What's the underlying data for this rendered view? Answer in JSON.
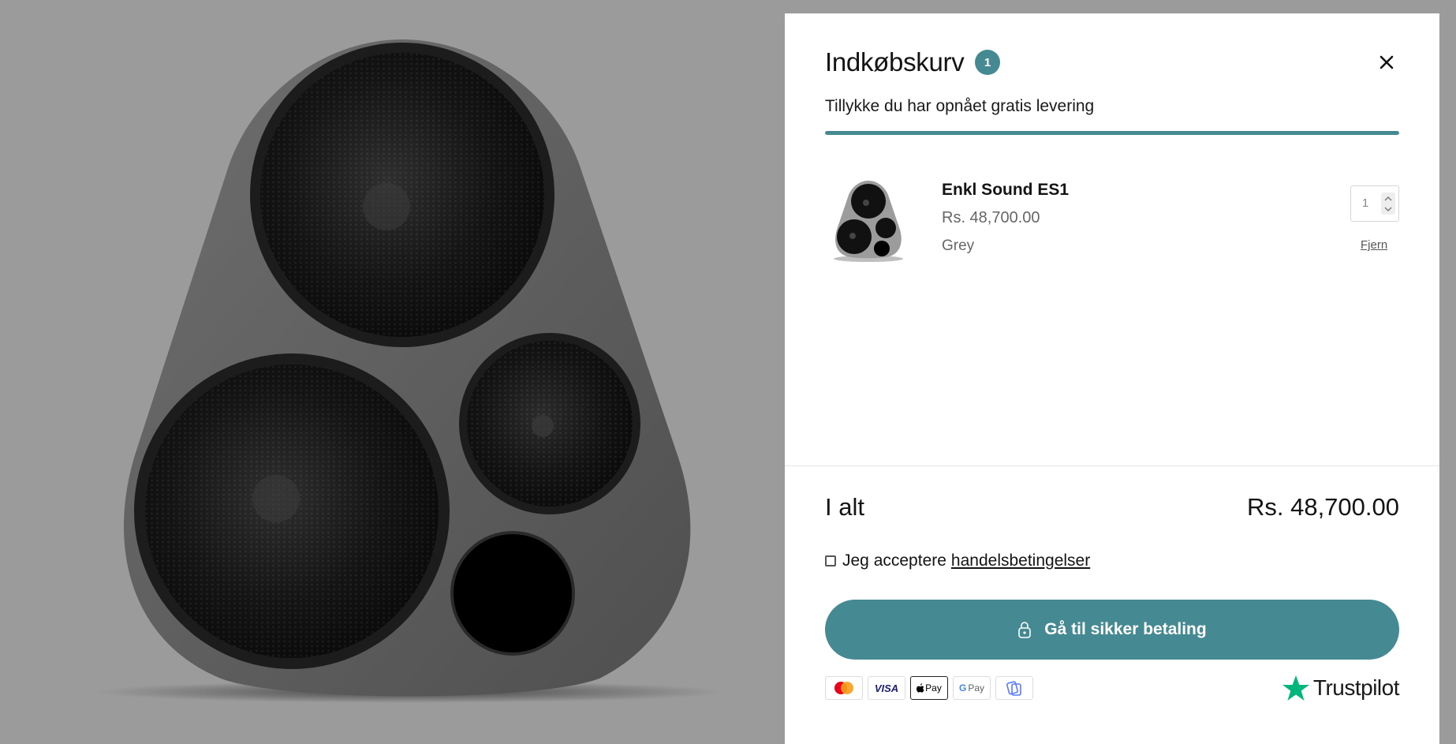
{
  "colors": {
    "accent": "#458a92",
    "backdrop": "#9b9b9b",
    "trustpilot_green": "#00b67a"
  },
  "hero": {
    "icon": "speaker-image"
  },
  "cart": {
    "title": "Indkøbskurv",
    "count": "1",
    "close_icon": "close-icon",
    "shipping_message": "Tillykke du har opnået gratis levering",
    "shipping_progress": 1.0,
    "items": [
      {
        "name": "Enkl Sound ES1",
        "price": "Rs. 48,700.00",
        "variant": "Grey",
        "quantity": "1",
        "remove_label": "Fjern"
      }
    ]
  },
  "summary": {
    "total_label": "I alt",
    "total_value": "Rs. 48,700.00",
    "terms_prefix": "Jeg acceptere",
    "terms_link": "handelsbetingelser",
    "terms_checked": false,
    "checkout_label": "Gå til sikker betaling",
    "checkout_icon": "lock-icon"
  },
  "payments": {
    "methods": [
      "mastercard-icon",
      "visa-icon",
      "apple-pay-icon",
      "google-pay-icon",
      "mobilepay-icon"
    ],
    "visa_text": "VISA",
    "applepay_text": "Pay",
    "gpay_g": "G",
    "gpay_text": "Pay"
  },
  "trustpilot": {
    "label": "Trustpilot",
    "icon": "trustpilot-star-icon"
  }
}
